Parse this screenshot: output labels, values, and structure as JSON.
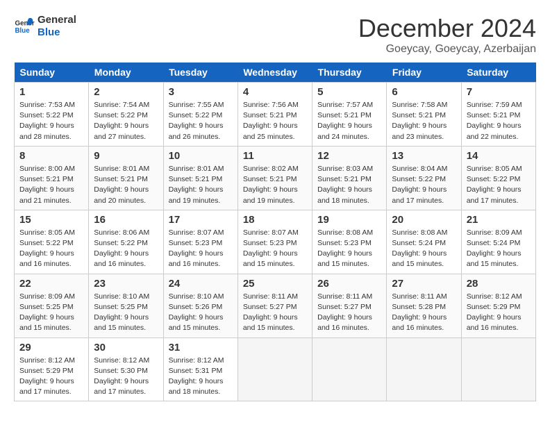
{
  "logo": {
    "line1": "General",
    "line2": "Blue"
  },
  "title": "December 2024",
  "subtitle": "Goeycay, Goeycay, Azerbaijan",
  "days_of_week": [
    "Sunday",
    "Monday",
    "Tuesday",
    "Wednesday",
    "Thursday",
    "Friday",
    "Saturday"
  ],
  "weeks": [
    [
      {
        "day": "1",
        "sunrise": "7:53 AM",
        "sunset": "5:22 PM",
        "daylight": "9 hours and 28 minutes."
      },
      {
        "day": "2",
        "sunrise": "7:54 AM",
        "sunset": "5:22 PM",
        "daylight": "9 hours and 27 minutes."
      },
      {
        "day": "3",
        "sunrise": "7:55 AM",
        "sunset": "5:22 PM",
        "daylight": "9 hours and 26 minutes."
      },
      {
        "day": "4",
        "sunrise": "7:56 AM",
        "sunset": "5:21 PM",
        "daylight": "9 hours and 25 minutes."
      },
      {
        "day": "5",
        "sunrise": "7:57 AM",
        "sunset": "5:21 PM",
        "daylight": "9 hours and 24 minutes."
      },
      {
        "day": "6",
        "sunrise": "7:58 AM",
        "sunset": "5:21 PM",
        "daylight": "9 hours and 23 minutes."
      },
      {
        "day": "7",
        "sunrise": "7:59 AM",
        "sunset": "5:21 PM",
        "daylight": "9 hours and 22 minutes."
      }
    ],
    [
      {
        "day": "8",
        "sunrise": "8:00 AM",
        "sunset": "5:21 PM",
        "daylight": "9 hours and 21 minutes."
      },
      {
        "day": "9",
        "sunrise": "8:01 AM",
        "sunset": "5:21 PM",
        "daylight": "9 hours and 20 minutes."
      },
      {
        "day": "10",
        "sunrise": "8:01 AM",
        "sunset": "5:21 PM",
        "daylight": "9 hours and 19 minutes."
      },
      {
        "day": "11",
        "sunrise": "8:02 AM",
        "sunset": "5:21 PM",
        "daylight": "9 hours and 19 minutes."
      },
      {
        "day": "12",
        "sunrise": "8:03 AM",
        "sunset": "5:21 PM",
        "daylight": "9 hours and 18 minutes."
      },
      {
        "day": "13",
        "sunrise": "8:04 AM",
        "sunset": "5:22 PM",
        "daylight": "9 hours and 17 minutes."
      },
      {
        "day": "14",
        "sunrise": "8:05 AM",
        "sunset": "5:22 PM",
        "daylight": "9 hours and 17 minutes."
      }
    ],
    [
      {
        "day": "15",
        "sunrise": "8:05 AM",
        "sunset": "5:22 PM",
        "daylight": "9 hours and 16 minutes."
      },
      {
        "day": "16",
        "sunrise": "8:06 AM",
        "sunset": "5:22 PM",
        "daylight": "9 hours and 16 minutes."
      },
      {
        "day": "17",
        "sunrise": "8:07 AM",
        "sunset": "5:23 PM",
        "daylight": "9 hours and 16 minutes."
      },
      {
        "day": "18",
        "sunrise": "8:07 AM",
        "sunset": "5:23 PM",
        "daylight": "9 hours and 15 minutes."
      },
      {
        "day": "19",
        "sunrise": "8:08 AM",
        "sunset": "5:23 PM",
        "daylight": "9 hours and 15 minutes."
      },
      {
        "day": "20",
        "sunrise": "8:08 AM",
        "sunset": "5:24 PM",
        "daylight": "9 hours and 15 minutes."
      },
      {
        "day": "21",
        "sunrise": "8:09 AM",
        "sunset": "5:24 PM",
        "daylight": "9 hours and 15 minutes."
      }
    ],
    [
      {
        "day": "22",
        "sunrise": "8:09 AM",
        "sunset": "5:25 PM",
        "daylight": "9 hours and 15 minutes."
      },
      {
        "day": "23",
        "sunrise": "8:10 AM",
        "sunset": "5:25 PM",
        "daylight": "9 hours and 15 minutes."
      },
      {
        "day": "24",
        "sunrise": "8:10 AM",
        "sunset": "5:26 PM",
        "daylight": "9 hours and 15 minutes."
      },
      {
        "day": "25",
        "sunrise": "8:11 AM",
        "sunset": "5:27 PM",
        "daylight": "9 hours and 15 minutes."
      },
      {
        "day": "26",
        "sunrise": "8:11 AM",
        "sunset": "5:27 PM",
        "daylight": "9 hours and 16 minutes."
      },
      {
        "day": "27",
        "sunrise": "8:11 AM",
        "sunset": "5:28 PM",
        "daylight": "9 hours and 16 minutes."
      },
      {
        "day": "28",
        "sunrise": "8:12 AM",
        "sunset": "5:29 PM",
        "daylight": "9 hours and 16 minutes."
      }
    ],
    [
      {
        "day": "29",
        "sunrise": "8:12 AM",
        "sunset": "5:29 PM",
        "daylight": "9 hours and 17 minutes."
      },
      {
        "day": "30",
        "sunrise": "8:12 AM",
        "sunset": "5:30 PM",
        "daylight": "9 hours and 17 minutes."
      },
      {
        "day": "31",
        "sunrise": "8:12 AM",
        "sunset": "5:31 PM",
        "daylight": "9 hours and 18 minutes."
      },
      null,
      null,
      null,
      null
    ]
  ]
}
